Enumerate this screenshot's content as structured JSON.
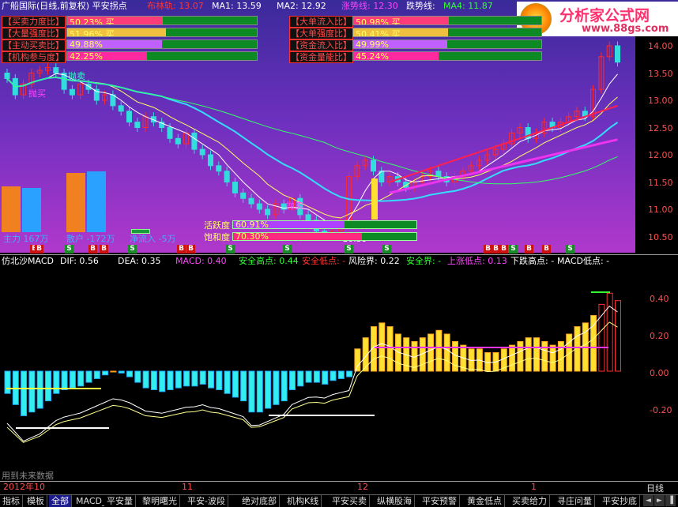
{
  "header": {
    "title": "广船国际(日线,前复权) 平安拐点",
    "ma_items": [
      {
        "label": "布林轨: 13.07",
        "color": "#ff3333"
      },
      {
        "label": "MA1: 13.59",
        "color": "#ffffff"
      },
      {
        "label": "MA2: 12.92",
        "color": "#ffffff"
      },
      {
        "label": "涨势线: 12.30",
        "color": "#ff44ff"
      },
      {
        "label": "跌势线: ",
        "color": "#ffffff"
      },
      {
        "label": "MA4: 11.87",
        "color": "#33ff33"
      }
    ]
  },
  "logo": {
    "text": "分析家公式网",
    "url": "www.88gs.com"
  },
  "left_gauges": [
    {
      "label": "买卖力度比",
      "value": "50.23% 买",
      "fraction": 0.5023,
      "fill": "#ff3c7a"
    },
    {
      "label": "大量强度比",
      "value": "51.96% 买",
      "fraction": 0.5196,
      "fill": "#f0c040"
    },
    {
      "label": "主动买卖比",
      "value": "49.88%",
      "fraction": 0.4988,
      "fill": "#c060ff"
    },
    {
      "label": "机构参与度",
      "value": "42.25%",
      "fraction": 0.4225,
      "fill": "#ff2aa0"
    }
  ],
  "right_gauges": [
    {
      "label": "大单流入比",
      "value": "50.98% 买",
      "fraction": 0.5098,
      "fill": "#ff3c7a"
    },
    {
      "label": "大单强度比",
      "value": "50.41% 买",
      "fraction": 0.5041,
      "fill": "#f0c040"
    },
    {
      "label": "资金流入比",
      "value": "49.99%",
      "fraction": 0.4999,
      "fill": "#c060ff"
    },
    {
      "label": "资金量能比",
      "value": "45.24%",
      "fraction": 0.4524,
      "fill": "#ff2aa0"
    }
  ],
  "main_chart": {
    "price_axis": [
      "14.00",
      "13.50",
      "13.00",
      "12.50",
      "12.00",
      "11.50",
      "11.00",
      "10.50"
    ],
    "annotations": {
      "buy_left": "抛买",
      "sell_left": "抛卖",
      "sell_low": "抛卖",
      "low_price": "←10.39"
    },
    "flow": {
      "main": "主力 167万",
      "retail": "散户 -172万",
      "net": "净流入 -5万"
    },
    "activity": {
      "label": "活跃度",
      "value": "60.91%",
      "fraction": 0.6091
    },
    "saturation": {
      "label": "饱和度",
      "value": "70.30%",
      "fraction": 0.703
    }
  },
  "macd_panel": {
    "title": "仿北沙MACD",
    "items": [
      {
        "label": "DIF: 0.56",
        "color": "#ffffff"
      },
      {
        "label": "DEA: 0.35",
        "color": "#ffffff"
      },
      {
        "label": "MACD: 0.40",
        "color": "#ff44ff"
      },
      {
        "label": "安全高点: 0.44",
        "color": "#33ff33"
      },
      {
        "label": "安全低点: -",
        "color": "#ff3333"
      },
      {
        "label": "风险界: 0.22",
        "color": "#ffffff"
      },
      {
        "label": "安全界: -",
        "color": "#33ff33"
      },
      {
        "label": "上涨低点: 0.13",
        "color": "#ff44ff"
      },
      {
        "label": "下跌高点: -",
        "color": "#ffffff"
      },
      {
        "label": "MACD低点: -",
        "color": "#ffffff"
      }
    ],
    "axis": [
      "0.40",
      "0.20",
      "0.00",
      "-0.20"
    ],
    "future_note": "用到未来数据"
  },
  "time_axis": {
    "labels": [
      "2012年10",
      "11",
      "12",
      "1"
    ],
    "period": "日线"
  },
  "tabs": [
    "指标",
    "模板",
    "全部",
    "MACD_",
    "平安量",
    "黎明曙光",
    "平安-波段",
    "绝对底部",
    "机构K线",
    "平安买卖",
    "纵横股海",
    "平安预警",
    "黄金低点",
    "买卖给力",
    "寻庄问量",
    "平安抄底"
  ],
  "active_tab": "全部",
  "colors": {
    "up": "#ff2a2a",
    "down": "#33dddd",
    "yellow": "#ffe030",
    "magenta": "#ee33ee",
    "bg_top": "#4a2aa8",
    "bg_bottom": "#b038c8"
  }
}
